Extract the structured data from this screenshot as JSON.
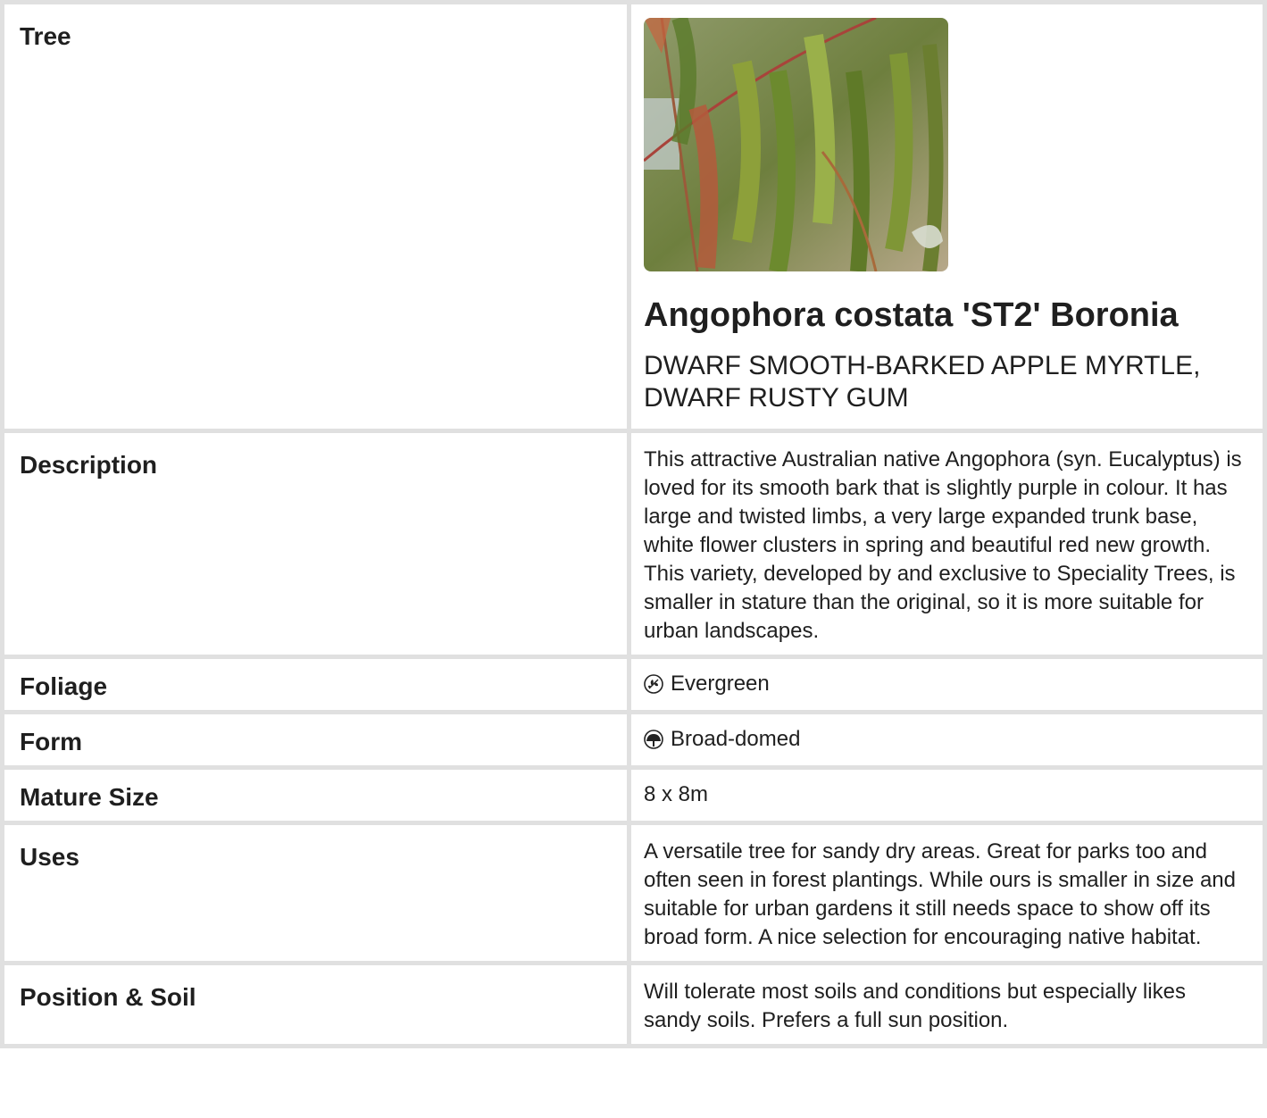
{
  "header": {
    "label": "Tree",
    "botanical_name": "Angophora costata 'ST2' Boronia",
    "common_name": "DWARF SMOOTH-BARKED APPLE MYRTLE, DWARF RUSTY GUM"
  },
  "rows": {
    "description": {
      "label": "Description",
      "value": "This attractive Australian native Angophora (syn. Eucalyptus) is loved for its smooth bark that is slightly purple in colour. It has large and twisted limbs, a very large expanded trunk base, white flower clusters in spring and beautiful red new growth. This variety, developed by and exclusive to Speciality Trees, is smaller in stature than the original, so it is more suitable for urban landscapes."
    },
    "foliage": {
      "label": "Foliage",
      "value": "Evergreen",
      "icon": "evergreen-leaf-icon"
    },
    "form": {
      "label": "Form",
      "value": "Broad-domed",
      "icon": "broad-domed-tree-icon"
    },
    "mature_size": {
      "label": "Mature Size",
      "value": "8 x 8m"
    },
    "uses": {
      "label": "Uses",
      "value": "A versatile tree for sandy dry areas. Great for parks too and often seen in forest plantings. While ours is smaller in size and suitable for urban gardens it still needs space to show off its broad form. A nice selection for encouraging native habitat."
    },
    "position_soil": {
      "label": "Position & Soil",
      "value": "Will tolerate most soils and conditions but especially likes sandy soils. Prefers a full sun position."
    }
  },
  "colors": {
    "border": "#e0e0e0",
    "text": "#1f1f1f"
  }
}
